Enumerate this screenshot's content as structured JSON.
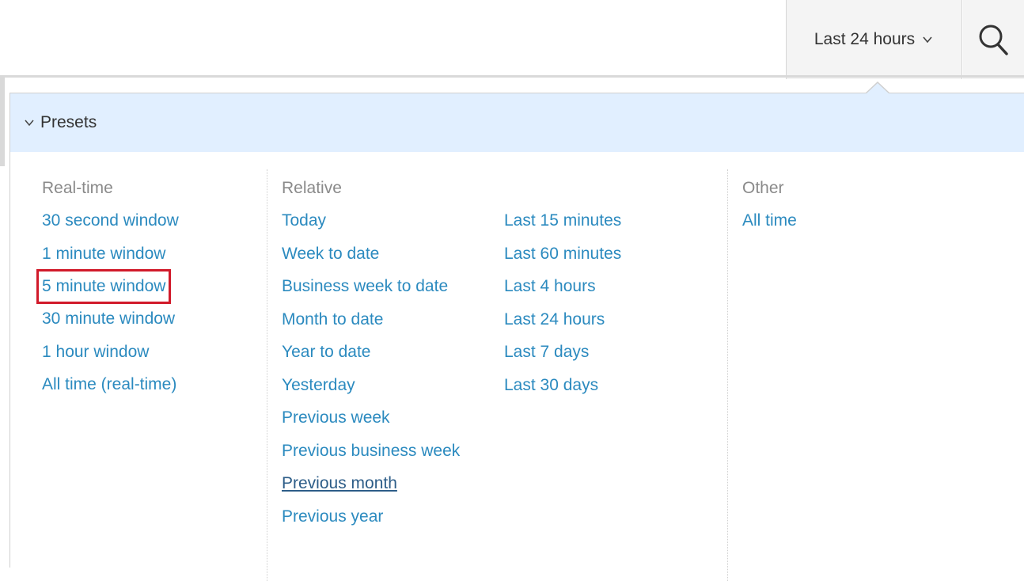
{
  "toolbar": {
    "time_range_label": "Last 24 hours",
    "chevron_icon": "chevron-down-icon",
    "search_icon": "search-icon"
  },
  "presets": {
    "header_label": "Presets",
    "realtime": {
      "title": "Real-time",
      "items": [
        "30 second window",
        "1 minute window",
        "5 minute window",
        "30 minute window",
        "1 hour window",
        "All time (real-time)"
      ],
      "highlighted": "5 minute window"
    },
    "relative": {
      "title": "Relative",
      "column_a": [
        "Today",
        "Week to date",
        "Business week to date",
        "Month to date",
        "Year to date",
        "Yesterday",
        "Previous week",
        "Previous business week",
        "Previous month",
        "Previous year"
      ],
      "column_b": [
        "Last 15 minutes",
        "Last 60 minutes",
        "Last 4 hours",
        "Last 24 hours",
        "Last 7 days",
        "Last 30 days"
      ],
      "hovered": "Previous month"
    },
    "other": {
      "title": "Other",
      "items": [
        "All time"
      ]
    }
  },
  "colors": {
    "link": "#2b8abf",
    "header_bg": "#e1efff",
    "highlight_box": "#d11a2a",
    "muted_title": "#8a8a8a"
  }
}
